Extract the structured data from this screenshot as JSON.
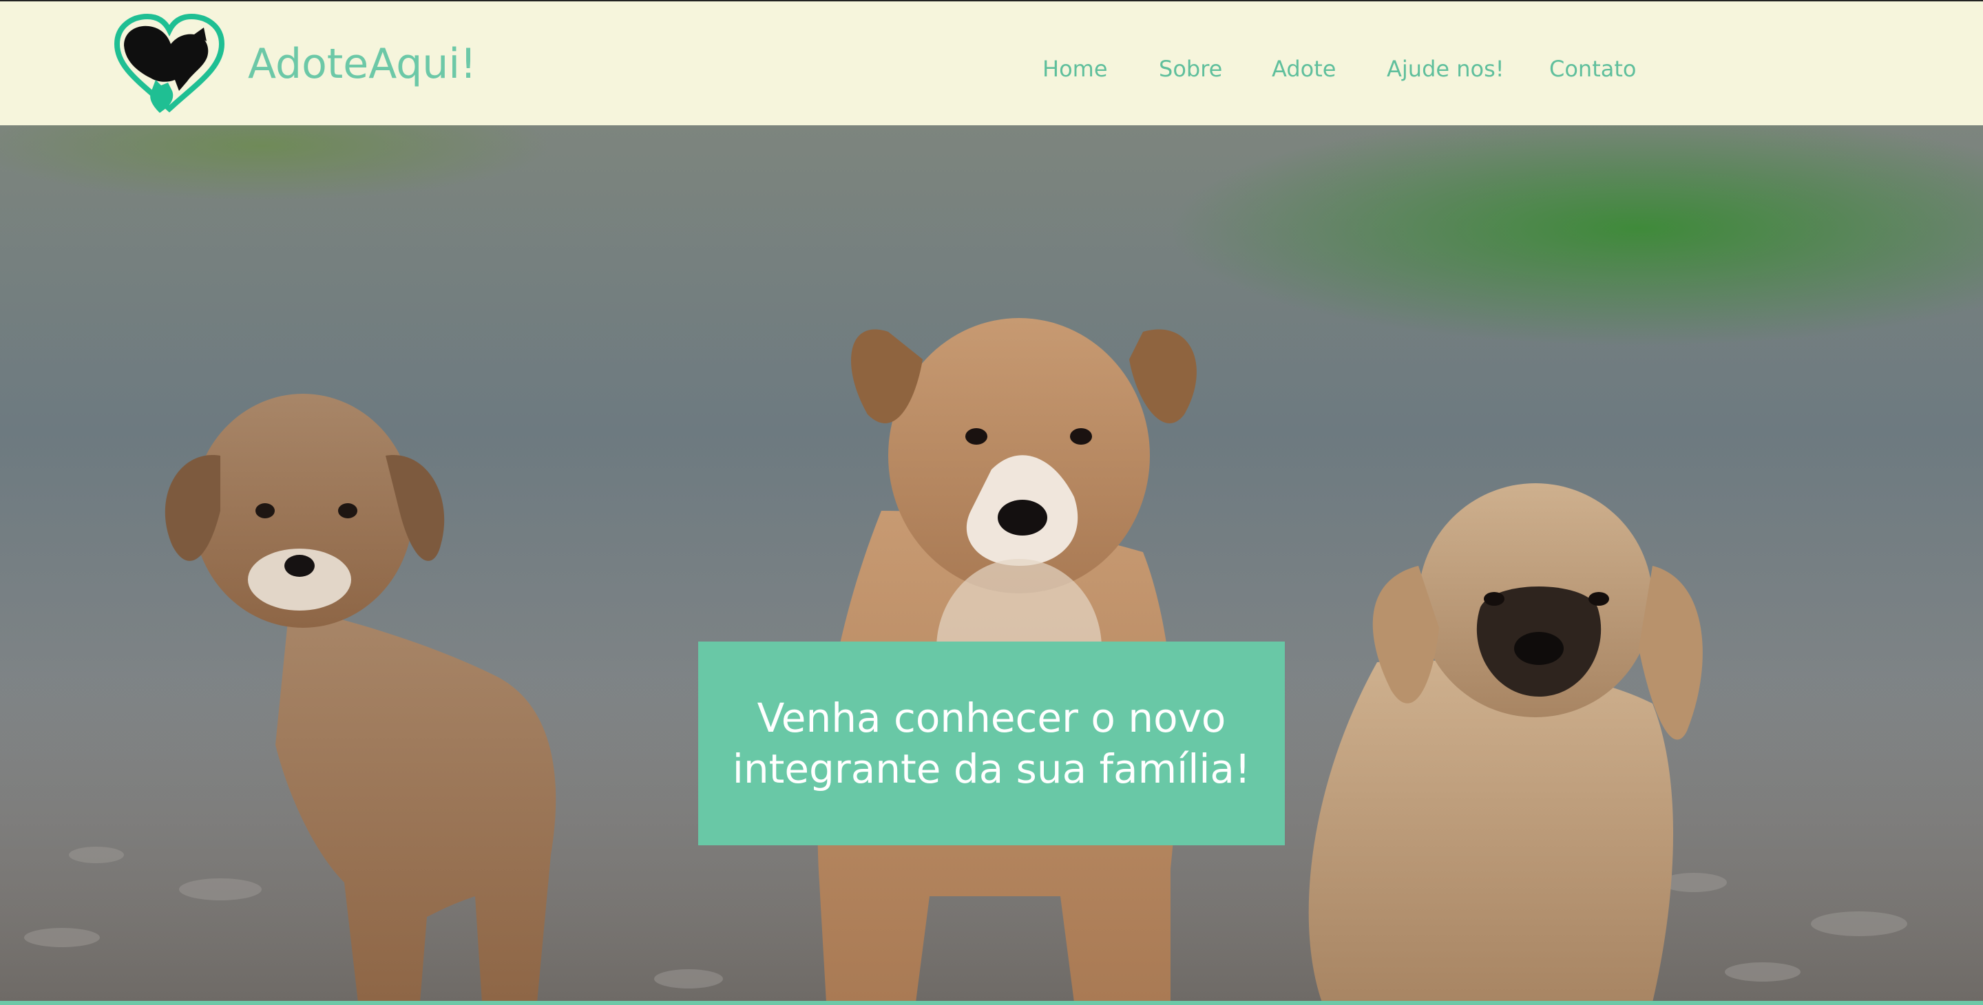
{
  "header": {
    "brand": "AdoteAqui!",
    "logo_icon": "heart-dog-cat-logo",
    "nav": [
      {
        "label": "Home"
      },
      {
        "label": "Sobre"
      },
      {
        "label": "Adote"
      },
      {
        "label": "Ajude nos!"
      },
      {
        "label": "Contato"
      }
    ]
  },
  "hero": {
    "image": "three-puppies-photo",
    "headline": "Venha conhecer o novo integrante da sua família!"
  },
  "colors": {
    "header_bg": "#f6f5dc",
    "accent": "#69c8a6",
    "text_on_accent": "#ffffff"
  }
}
